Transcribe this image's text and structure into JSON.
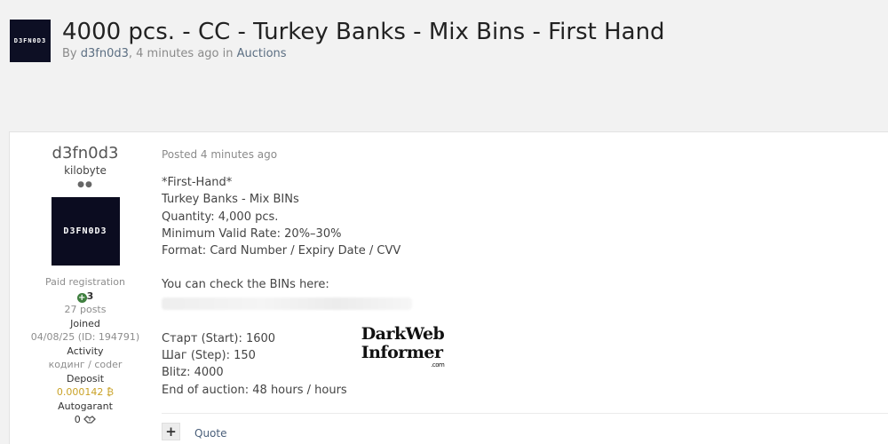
{
  "header": {
    "avatar_text": "D3FN0D3",
    "title": "4000 pcs. - CC - Turkey Banks - Mix Bins - First Hand",
    "by_prefix": "By ",
    "author": "d3fn0d3",
    "time_text": ", 4 minutes ago in ",
    "forum": "Auctions"
  },
  "post": {
    "author": {
      "name": "d3fn0d3",
      "rank": "kilobyte",
      "rank_dots": "●●",
      "avatar_text": "D3FN0D3",
      "group": "Paid registration",
      "reputation": "3",
      "posts": "27 posts",
      "joined_label": "Joined",
      "joined_value": "04/08/25 (ID: 194791)",
      "activity_label": "Activity",
      "activity_value": "кодинг / coder",
      "deposit_label": "Deposit",
      "deposit_value": "0.000142 ₿",
      "autogarant_label": "Autogarant",
      "autogarant_value": "0"
    },
    "posted": "Posted 4 minutes ago",
    "lines": [
      "*First-Hand*",
      "Turkey Banks - Mix BINs",
      "Quantity: 4,000 pcs.",
      "Minimum Valid Rate: 20%–30%",
      "Format: Card Number / Expiry Date / CVV"
    ],
    "bins_note": "You can check the BINs here:",
    "auction": [
      "Старт (Start): 1600",
      "Шаг (Step): 150",
      "Blitz: 4000",
      "End of auction: 48 hours / hours"
    ],
    "watermark": {
      "line1": "DarkWeb",
      "line2": "Informer",
      "line3": ".com"
    },
    "actions": {
      "plus": "+",
      "quote": "Quote"
    }
  }
}
